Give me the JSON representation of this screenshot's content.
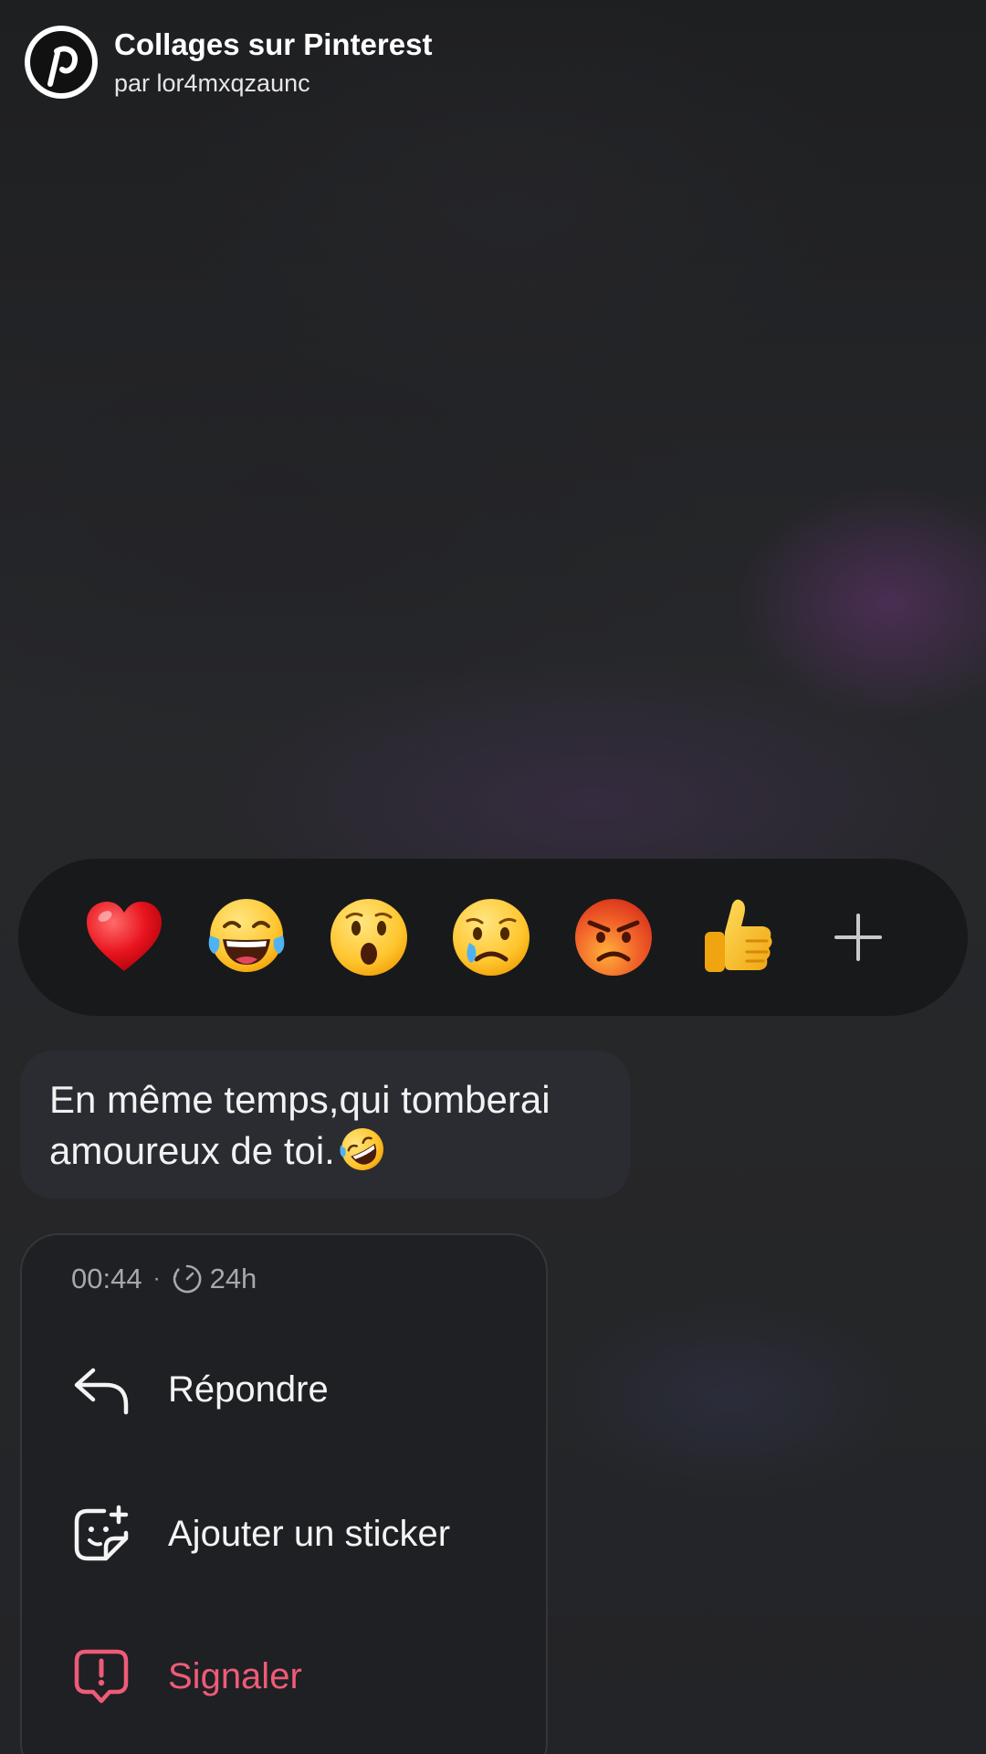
{
  "header": {
    "title": "Collages sur Pinterest",
    "subtitle": "par lor4mxqzaunc",
    "logo_icon": "pinterest-logo-icon"
  },
  "reactions": {
    "items": [
      {
        "name": "heart",
        "icon": "red-heart-emoji"
      },
      {
        "name": "laugh",
        "icon": "tears-of-joy-emoji"
      },
      {
        "name": "wow",
        "icon": "surprised-face-emoji"
      },
      {
        "name": "sad",
        "icon": "crying-face-emoji"
      },
      {
        "name": "angry",
        "icon": "angry-face-emoji"
      },
      {
        "name": "like",
        "icon": "thumbs-up-emoji"
      }
    ],
    "more_icon": "plus-icon"
  },
  "message": {
    "text_line1": "En même temps,qui tomberai",
    "text_line2": "amoureux de toi.",
    "emoji_icon": "rolling-on-floor-laughing-emoji"
  },
  "menu": {
    "time": "00:44",
    "separator": "·",
    "expiry": "24h",
    "items": [
      {
        "label": "Répondre",
        "icon": "reply-arrow-icon"
      },
      {
        "label": "Ajouter un sticker",
        "icon": "add-sticker-icon"
      },
      {
        "label": "Signaler",
        "icon": "report-icon"
      }
    ]
  },
  "colors": {
    "background": "#222326",
    "danger": "#ee5b78",
    "pinterest_red": "#e60023"
  }
}
